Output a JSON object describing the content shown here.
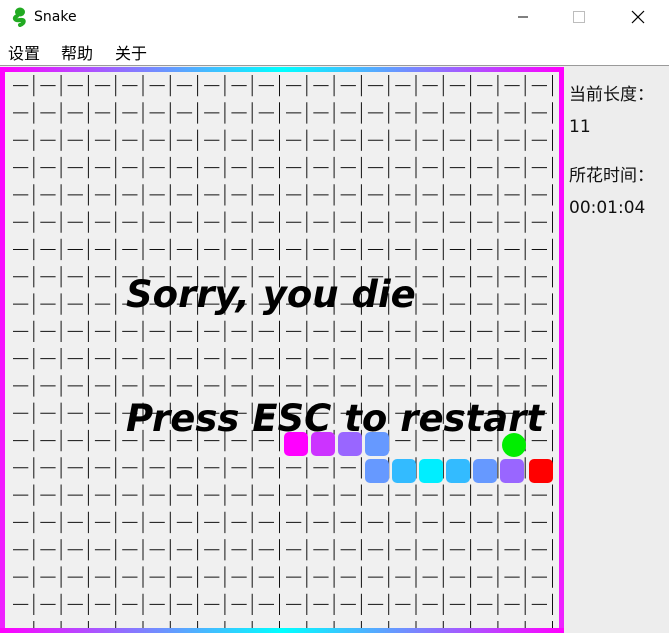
{
  "window": {
    "title": "Snake"
  },
  "menu": {
    "items": [
      "设置",
      "帮助",
      "关于"
    ]
  },
  "game": {
    "message_1": "Sorry, you die",
    "message_2": "Press ESC to restart",
    "snake_colors": [
      "#ff00ff",
      "#cc33ff",
      "#9966ff",
      "#6699ff",
      "#6699ff",
      "#33bbff",
      "#00eeff",
      "#33bbff",
      "#6699ff",
      "#9966ff",
      "#ff0000"
    ],
    "food_color": "#00ee00",
    "border_gradient": [
      "#ff00ff",
      "#00ffff",
      "#ff00ff"
    ]
  },
  "panel": {
    "length_label": "当前长度：",
    "length_value": "11",
    "time_label": "所花时间：",
    "time_value": "00:01:04"
  }
}
